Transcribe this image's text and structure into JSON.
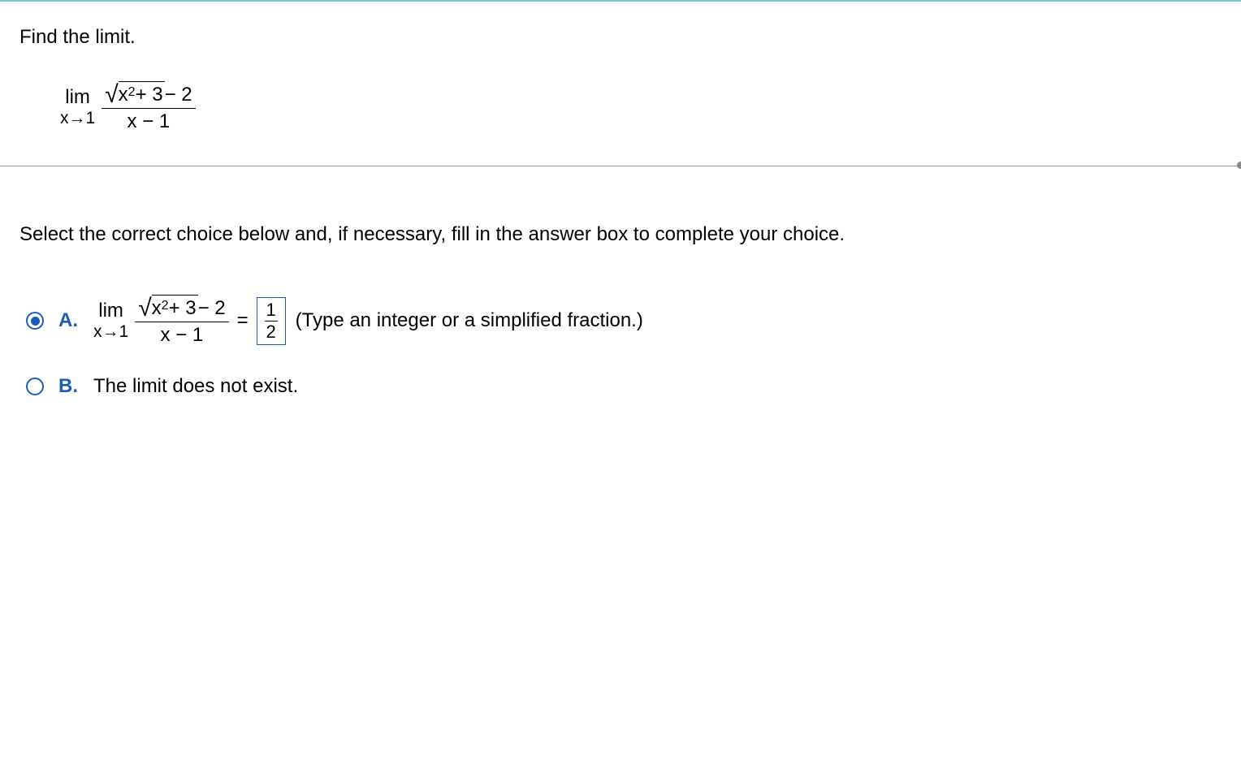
{
  "question": {
    "prompt": "Find the limit.",
    "limit": {
      "lim_text": "lim",
      "approach": "x→1",
      "numerator_sqrt_inner_base": "x",
      "numerator_sqrt_inner_exp": "2",
      "numerator_sqrt_inner_tail": " + 3",
      "numerator_tail": " − 2",
      "denominator": "x − 1"
    }
  },
  "instruction": "Select the correct choice below and, if necessary, fill in the answer box to complete your choice.",
  "choices": {
    "a": {
      "label": "A.",
      "selected": true,
      "limit": {
        "lim_text": "lim",
        "approach": "x→1",
        "numerator_sqrt_inner_base": "x",
        "numerator_sqrt_inner_exp": "2",
        "numerator_sqrt_inner_tail": " + 3",
        "numerator_tail": " − 2",
        "denominator": "x − 1"
      },
      "equals": "=",
      "answer": {
        "num": "1",
        "den": "2"
      },
      "hint": "(Type an integer or a simplified fraction.)"
    },
    "b": {
      "label": "B.",
      "selected": false,
      "text": "The limit does not exist."
    }
  }
}
